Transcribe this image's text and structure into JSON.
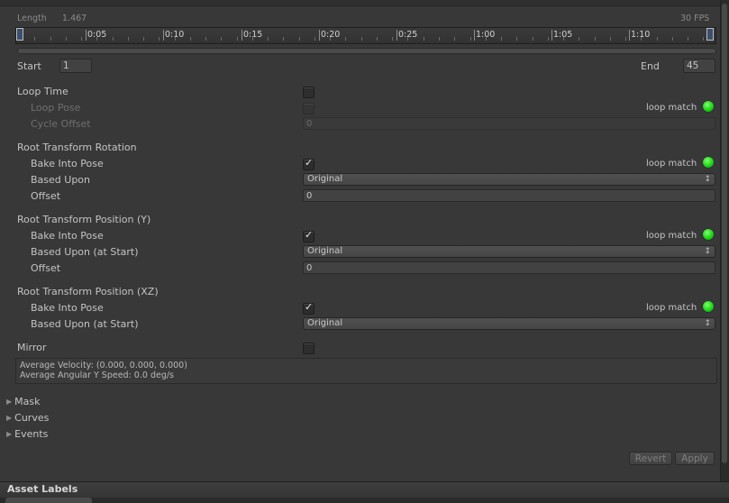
{
  "header": {
    "length_label": "Length",
    "length_value": "1.467",
    "fps": "30 FPS"
  },
  "timeline": {
    "ticks": [
      "0:05",
      "0:10",
      "0:15",
      "0:20",
      "0:25",
      "1:00",
      "1:05",
      "1:10"
    ]
  },
  "range": {
    "start_label": "Start",
    "start_value": "1",
    "end_label": "End",
    "end_value": "45"
  },
  "loop": {
    "loop_time": "Loop Time",
    "loop_pose": "Loop Pose",
    "cycle_offset": "Cycle Offset",
    "cycle_offset_value": "0",
    "loop_match": "loop match"
  },
  "rotation": {
    "title": "Root Transform Rotation",
    "bake": "Bake Into Pose",
    "based_upon": "Based Upon",
    "based_upon_value": "Original",
    "offset": "Offset",
    "offset_value": "0",
    "loop_match": "loop match"
  },
  "position_y": {
    "title": "Root Transform Position (Y)",
    "bake": "Bake Into Pose",
    "based_upon": "Based Upon (at Start)",
    "based_upon_value": "Original",
    "offset": "Offset",
    "offset_value": "0",
    "loop_match": "loop match"
  },
  "position_xz": {
    "title": "Root Transform Position (XZ)",
    "bake": "Bake Into Pose",
    "based_upon": "Based Upon (at Start)",
    "based_upon_value": "Original",
    "loop_match": "loop match"
  },
  "mirror": {
    "label": "Mirror"
  },
  "info": {
    "velocity": "Average Velocity: (0.000, 0.000, 0.000)",
    "angular": "Average Angular Y Speed: 0.0 deg/s"
  },
  "foldouts": {
    "mask": "Mask",
    "curves": "Curves",
    "events": "Events"
  },
  "buttons": {
    "revert": "Revert",
    "apply": "Apply"
  },
  "footer": {
    "asset_labels": "Asset Labels"
  },
  "colors": {
    "panel_bg": "#383838",
    "loop_match_ok": "#1fd41a"
  }
}
